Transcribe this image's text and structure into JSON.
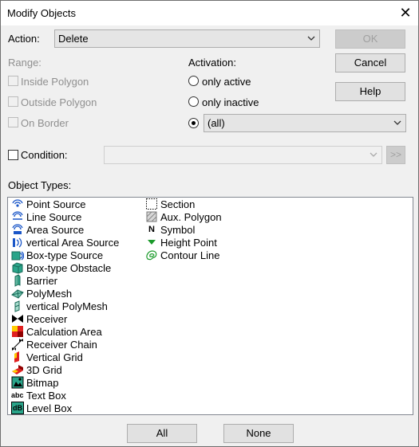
{
  "window": {
    "title": "Modify Objects"
  },
  "action": {
    "label": "Action:",
    "value": "Delete"
  },
  "buttons": {
    "ok": "OK",
    "cancel": "Cancel",
    "help": "Help",
    "all": "All",
    "none": "None",
    "more": ">>"
  },
  "range": {
    "label": "Range:",
    "options": [
      "Inside Polygon",
      "Outside Polygon",
      "On Border"
    ]
  },
  "activation": {
    "label": "Activation:",
    "options": [
      "only active",
      "only inactive"
    ],
    "selected_combo_value": "(all)"
  },
  "condition": {
    "label": "Condition:",
    "value": ""
  },
  "object_types": {
    "label": "Object Types:",
    "column1": [
      {
        "label": "Point Source",
        "icon": "point-source-icon"
      },
      {
        "label": "Line Source",
        "icon": "line-source-icon"
      },
      {
        "label": "Area Source",
        "icon": "area-source-icon"
      },
      {
        "label": "vertical Area Source",
        "icon": "vertical-area-source-icon"
      },
      {
        "label": "Box-type Source",
        "icon": "box-type-source-icon"
      },
      {
        "label": "Box-type Obstacle",
        "icon": "box-type-obstacle-icon"
      },
      {
        "label": "Barrier",
        "icon": "barrier-icon"
      },
      {
        "label": "PolyMesh",
        "icon": "polymesh-icon"
      },
      {
        "label": "vertical PolyMesh",
        "icon": "vertical-polymesh-icon"
      },
      {
        "label": "Receiver",
        "icon": "receiver-icon"
      },
      {
        "label": "Calculation Area",
        "icon": "calculation-area-icon"
      },
      {
        "label": "Receiver Chain",
        "icon": "receiver-chain-icon"
      },
      {
        "label": "Vertical Grid",
        "icon": "vertical-grid-icon"
      },
      {
        "label": "3D Grid",
        "icon": "3d-grid-icon"
      },
      {
        "label": "Bitmap",
        "icon": "bitmap-icon"
      },
      {
        "label": "Text Box",
        "icon": "text-box-icon"
      },
      {
        "label": "Level Box",
        "icon": "level-box-icon"
      }
    ],
    "column2": [
      {
        "label": "Section",
        "icon": "section-icon"
      },
      {
        "label": "Aux. Polygon",
        "icon": "aux-polygon-icon"
      },
      {
        "label": "Symbol",
        "icon": "symbol-icon"
      },
      {
        "label": "Height Point",
        "icon": "height-point-icon"
      },
      {
        "label": "Contour Line",
        "icon": "contour-line-icon"
      }
    ]
  },
  "icon_glyphs": {
    "symbol": "N",
    "text_box": "abc",
    "level_box": "dB"
  },
  "colors": {
    "source_blue": "#1a56c8",
    "obstacle_teal": "#2aa58a",
    "calc_red": "#e02020",
    "height_green": "#1a9a2a"
  }
}
